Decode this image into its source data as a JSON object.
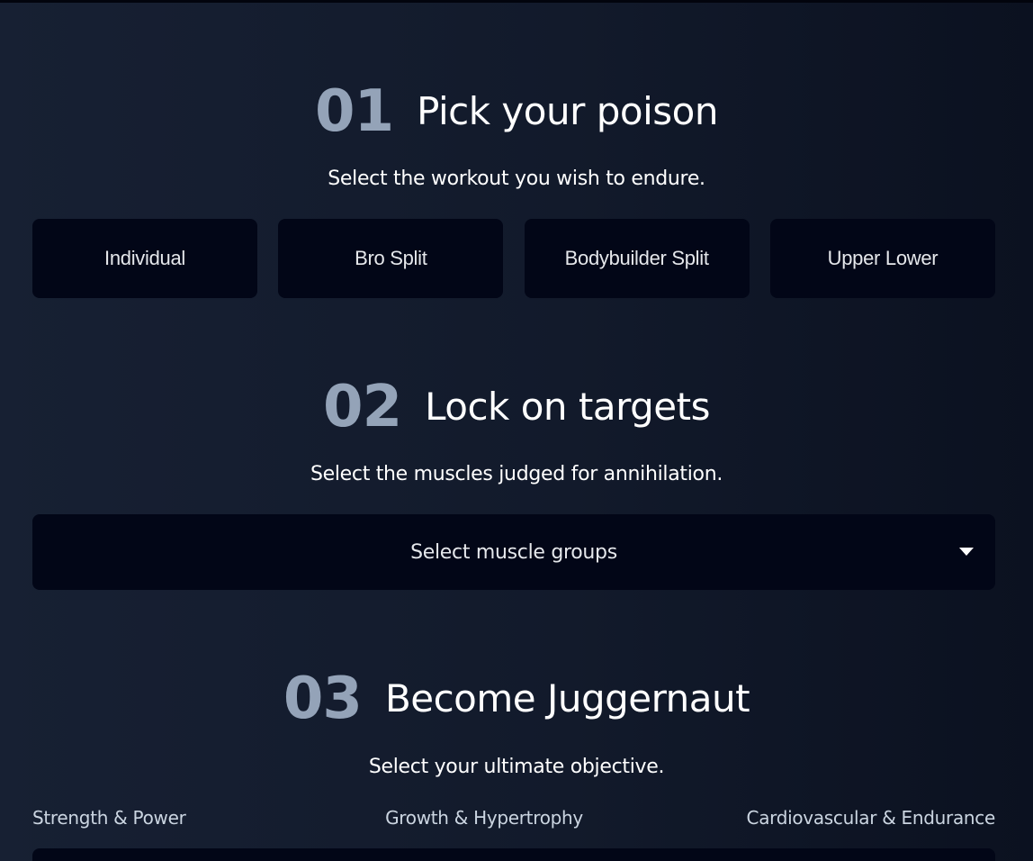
{
  "sections": [
    {
      "number": "01",
      "title": "Pick your poison",
      "subtitle": "Select the workout you wish to endure.",
      "options": [
        "Individual",
        "Bro Split",
        "Bodybuilder Split",
        "Upper Lower"
      ]
    },
    {
      "number": "02",
      "title": "Lock on targets",
      "subtitle": "Select the muscles judged for annihilation.",
      "select_placeholder": "Select muscle groups",
      "caret_icon": "caret-down-icon"
    },
    {
      "number": "03",
      "title": "Become Juggernaut",
      "subtitle": "Select your ultimate objective.",
      "objectives": [
        "Strength & Power",
        "Growth & Hypertrophy",
        "Cardiovascular & Endurance"
      ]
    }
  ],
  "colors": {
    "background_start": "#172033",
    "background_end": "#0b1120",
    "panel": "#020617",
    "number": "#94a3b8"
  }
}
